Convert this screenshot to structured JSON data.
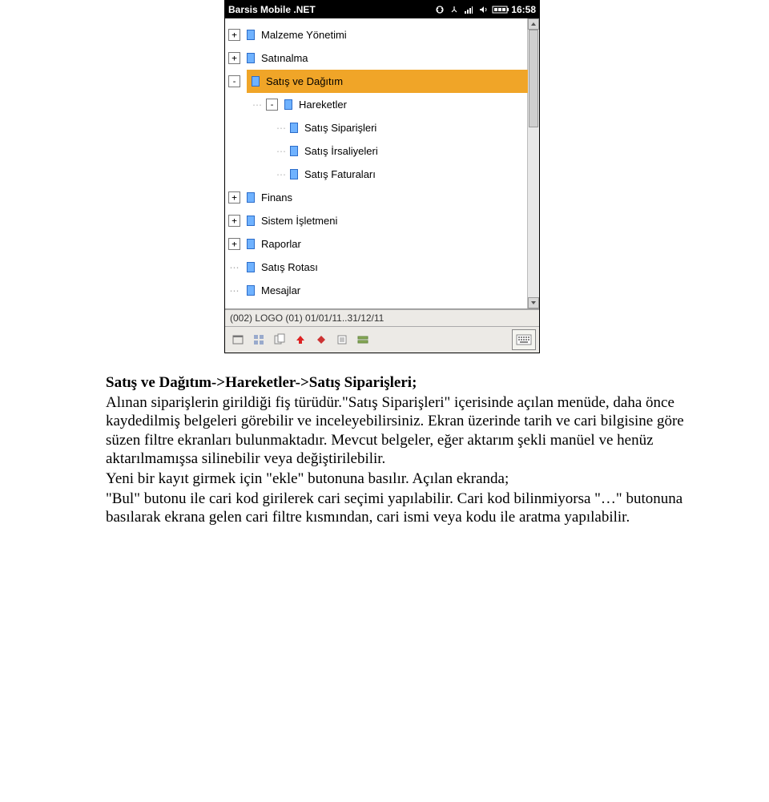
{
  "titlebar": {
    "app_title": "Barsis Mobile .NET",
    "time": "16:58"
  },
  "tree": {
    "items": [
      {
        "toggle": "+",
        "label": "Malzeme Yönetimi",
        "level": 0
      },
      {
        "toggle": "+",
        "label": "Satınalma",
        "level": 0
      },
      {
        "toggle": "-",
        "label": "Satış ve Dağıtım",
        "level": 0,
        "selected": true
      },
      {
        "toggle": "-",
        "label": "Hareketler",
        "level": 1
      },
      {
        "toggle": null,
        "label": "Satış Siparişleri",
        "level": 2
      },
      {
        "toggle": null,
        "label": "Satış İrsaliyeleri",
        "level": 2
      },
      {
        "toggle": null,
        "label": "Satış Faturaları",
        "level": 2
      },
      {
        "toggle": "+",
        "label": "Finans",
        "level": 0
      },
      {
        "toggle": "+",
        "label": "Sistem İşletmeni",
        "level": 0
      },
      {
        "toggle": "+",
        "label": "Raporlar",
        "level": 0
      },
      {
        "toggle": null,
        "label": "Satış Rotası",
        "level": 0,
        "notoggle": true
      },
      {
        "toggle": null,
        "label": "Mesajlar",
        "level": 0,
        "notoggle": true
      }
    ]
  },
  "statusbar": {
    "text": "(002) LOGO    (01) 01/01/11..31/12/11"
  },
  "paragraph": {
    "line1": "Satış ve Dağıtım->Hareketler->Satış Siparişleri;",
    "body": "Alınan siparişlerin girildiği fiş türüdür.\"Satış Siparişleri\" içerisinde açılan menüde, daha önce kaydedilmiş belgeleri görebilir ve inceleyebilirsiniz. Ekran üzerinde tarih ve cari bilgisine göre süzen filtre ekranları bulunmaktadır. Mevcut belgeler, eğer aktarım şekli manüel ve henüz aktarılmamışsa silinebilir veya değiştirilebilir.",
    "line3": "Yeni bir kayıt girmek için \"ekle\" butonuna basılır. Açılan ekranda;",
    "line4": "\"Bul\" butonu ile cari kod girilerek cari seçimi yapılabilir. Cari kod bilinmiyorsa \"…\" butonuna basılarak ekrana gelen cari filtre kısmından, cari ismi veya kodu ile aratma yapılabilir."
  }
}
